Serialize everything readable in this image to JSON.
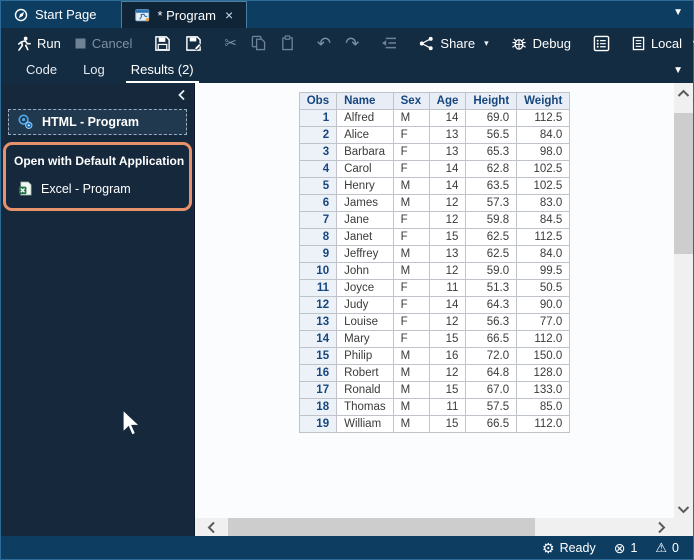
{
  "tab_bar": {
    "start_page_label": "Start Page",
    "program_label": "* Program",
    "close_glyph": "×"
  },
  "toolbar": {
    "run_label": "Run",
    "cancel_label": "Cancel",
    "share_label": "Share",
    "debug_label": "Debug",
    "local_label": "Local",
    "overflow_glyph": "⋮",
    "cut_glyph": "✂",
    "undo_glyph": "↶",
    "redo_glyph": "↷"
  },
  "subtabs": {
    "code_label": "Code",
    "log_label": "Log",
    "results_label": "Results (2)"
  },
  "sidebar": {
    "html_item_label": "HTML - Program",
    "callout_title": "Open with Default Application",
    "excel_item_label": "Excel - Program"
  },
  "table": {
    "headers": [
      "Obs",
      "Name",
      "Sex",
      "Age",
      "Height",
      "Weight"
    ],
    "rows": [
      [
        "1",
        "Alfred",
        "M",
        "14",
        "69.0",
        "112.5"
      ],
      [
        "2",
        "Alice",
        "F",
        "13",
        "56.5",
        "84.0"
      ],
      [
        "3",
        "Barbara",
        "F",
        "13",
        "65.3",
        "98.0"
      ],
      [
        "4",
        "Carol",
        "F",
        "14",
        "62.8",
        "102.5"
      ],
      [
        "5",
        "Henry",
        "M",
        "14",
        "63.5",
        "102.5"
      ],
      [
        "6",
        "James",
        "M",
        "12",
        "57.3",
        "83.0"
      ],
      [
        "7",
        "Jane",
        "F",
        "12",
        "59.8",
        "84.5"
      ],
      [
        "8",
        "Janet",
        "F",
        "15",
        "62.5",
        "112.5"
      ],
      [
        "9",
        "Jeffrey",
        "M",
        "13",
        "62.5",
        "84.0"
      ],
      [
        "10",
        "John",
        "M",
        "12",
        "59.0",
        "99.5"
      ],
      [
        "11",
        "Joyce",
        "F",
        "11",
        "51.3",
        "50.5"
      ],
      [
        "12",
        "Judy",
        "F",
        "14",
        "64.3",
        "90.0"
      ],
      [
        "13",
        "Louise",
        "F",
        "12",
        "56.3",
        "77.0"
      ],
      [
        "14",
        "Mary",
        "F",
        "15",
        "66.5",
        "112.0"
      ],
      [
        "15",
        "Philip",
        "M",
        "16",
        "72.0",
        "150.0"
      ],
      [
        "16",
        "Robert",
        "M",
        "12",
        "64.8",
        "128.0"
      ],
      [
        "17",
        "Ronald",
        "M",
        "15",
        "67.0",
        "133.0"
      ],
      [
        "18",
        "Thomas",
        "M",
        "11",
        "57.5",
        "85.0"
      ],
      [
        "19",
        "William",
        "M",
        "15",
        "66.5",
        "112.0"
      ]
    ]
  },
  "status_bar": {
    "ready_label": "Ready",
    "gear_glyph": "⚙",
    "error_glyph": "⊗",
    "error_count": "1",
    "warning_glyph": "⚠",
    "warning_count": "0"
  },
  "colors": {
    "titlebar_blue": "#0E3D62",
    "panel_navy": "#132C42",
    "sidebar_navy": "#16293C",
    "highlight_orange": "#E8926C",
    "table_header_bg": "#E9EEF6",
    "table_header_text": "#16467F",
    "table_border": "#BFC4CA"
  }
}
